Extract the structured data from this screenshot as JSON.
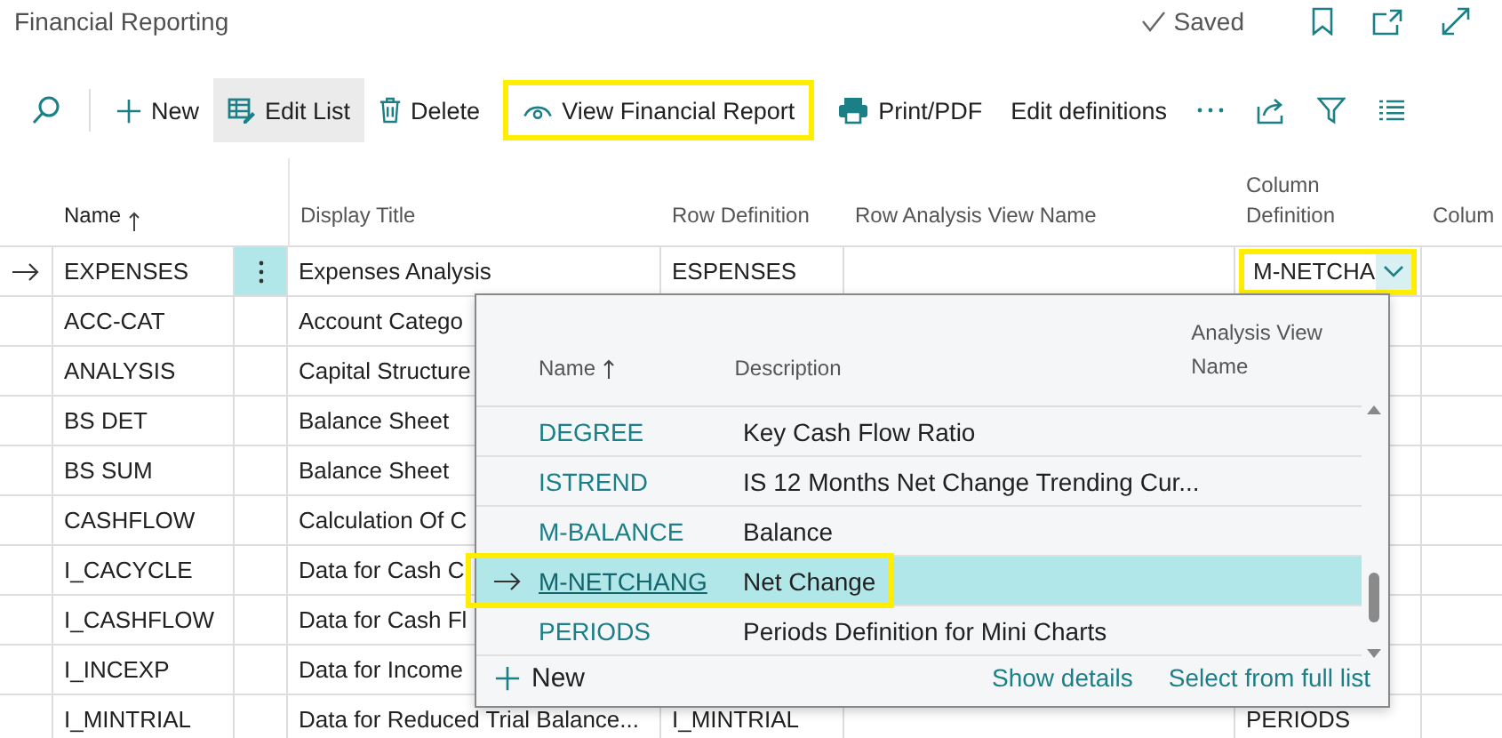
{
  "page": {
    "title": "Financial Reporting",
    "status": "Saved"
  },
  "toolbar": [
    {
      "kind": "search",
      "selected": false,
      "highlighted": false
    },
    {
      "kind": "new",
      "label": "New",
      "selected": false,
      "highlighted": false
    },
    {
      "kind": "edit-list",
      "label": "Edit List",
      "selected": true,
      "highlighted": false
    },
    {
      "kind": "delete",
      "label": "Delete",
      "selected": false,
      "highlighted": false
    },
    {
      "kind": "view",
      "label": "View Financial Report",
      "selected": false,
      "highlighted": true
    },
    {
      "kind": "print",
      "label": "Print/PDF",
      "selected": false,
      "highlighted": false
    },
    {
      "kind": "text",
      "label": "Edit definitions",
      "selected": false,
      "highlighted": false
    },
    {
      "kind": "more",
      "selected": false,
      "highlighted": false
    },
    {
      "kind": "share",
      "selected": false,
      "highlighted": false
    },
    {
      "kind": "filter",
      "selected": false,
      "highlighted": false
    },
    {
      "kind": "list",
      "selected": false,
      "highlighted": false
    }
  ],
  "table": {
    "columns": [
      {
        "label": "Name",
        "sorted": true
      },
      {
        "label": "Display Title",
        "sorted": false
      },
      {
        "label": "Row Definition",
        "sorted": false
      },
      {
        "label": "Row Analysis View Name",
        "sorted": false
      },
      {
        "label": "Column Definition",
        "sorted": false
      },
      {
        "label": "Colum",
        "sorted": false
      }
    ],
    "rows": [
      {
        "name": "EXPENSES",
        "display_title": "Expenses Analysis",
        "row_definition": "ESPENSES",
        "column_definition": "M-NETCHA",
        "selected": true
      },
      {
        "name": "ACC-CAT",
        "display_title": "Account Catego",
        "selected": false
      },
      {
        "name": "ANALYSIS",
        "display_title": "Capital Structure",
        "selected": false
      },
      {
        "name": "BS DET",
        "display_title": "Balance Sheet",
        "selected": false
      },
      {
        "name": "BS SUM",
        "display_title": "Balance Sheet",
        "selected": false
      },
      {
        "name": "CASHFLOW",
        "display_title": "Calculation Of C",
        "selected": false
      },
      {
        "name": "I_CACYCLE",
        "display_title": "Data for Cash C",
        "selected": false
      },
      {
        "name": "I_CASHFLOW",
        "display_title": "Data for Cash Fl",
        "selected": false
      },
      {
        "name": "I_INCEXP",
        "display_title": "Data for Income",
        "selected": false
      },
      {
        "name": "I_MINTRIAL",
        "display_title": "Data for Reduced Trial Balance...",
        "row_definition": "I_MINTRIAL",
        "column_definition": "PERIODS",
        "selected": false
      }
    ]
  },
  "lookup": {
    "columns": [
      {
        "label": "Name",
        "sorted": true
      },
      {
        "label": "Description",
        "sorted": false
      },
      {
        "label": "Analysis View Name",
        "sorted": false
      }
    ],
    "rows": [
      {
        "name": "DEGREE",
        "description": "Key Cash Flow Ratio",
        "selected": false
      },
      {
        "name": "ISTREND",
        "description": "IS 12 Months Net Change Trending Cur...",
        "selected": false
      },
      {
        "name": "M-BALANCE",
        "description": "Balance",
        "selected": false
      },
      {
        "name": "M-NETCHANG",
        "description": "Net Change",
        "selected": true
      },
      {
        "name": "PERIODS",
        "description": "Periods Definition for Mini Charts",
        "selected": false
      }
    ],
    "new_label": "New",
    "show_details": "Show details",
    "select_full": "Select from full list"
  }
}
